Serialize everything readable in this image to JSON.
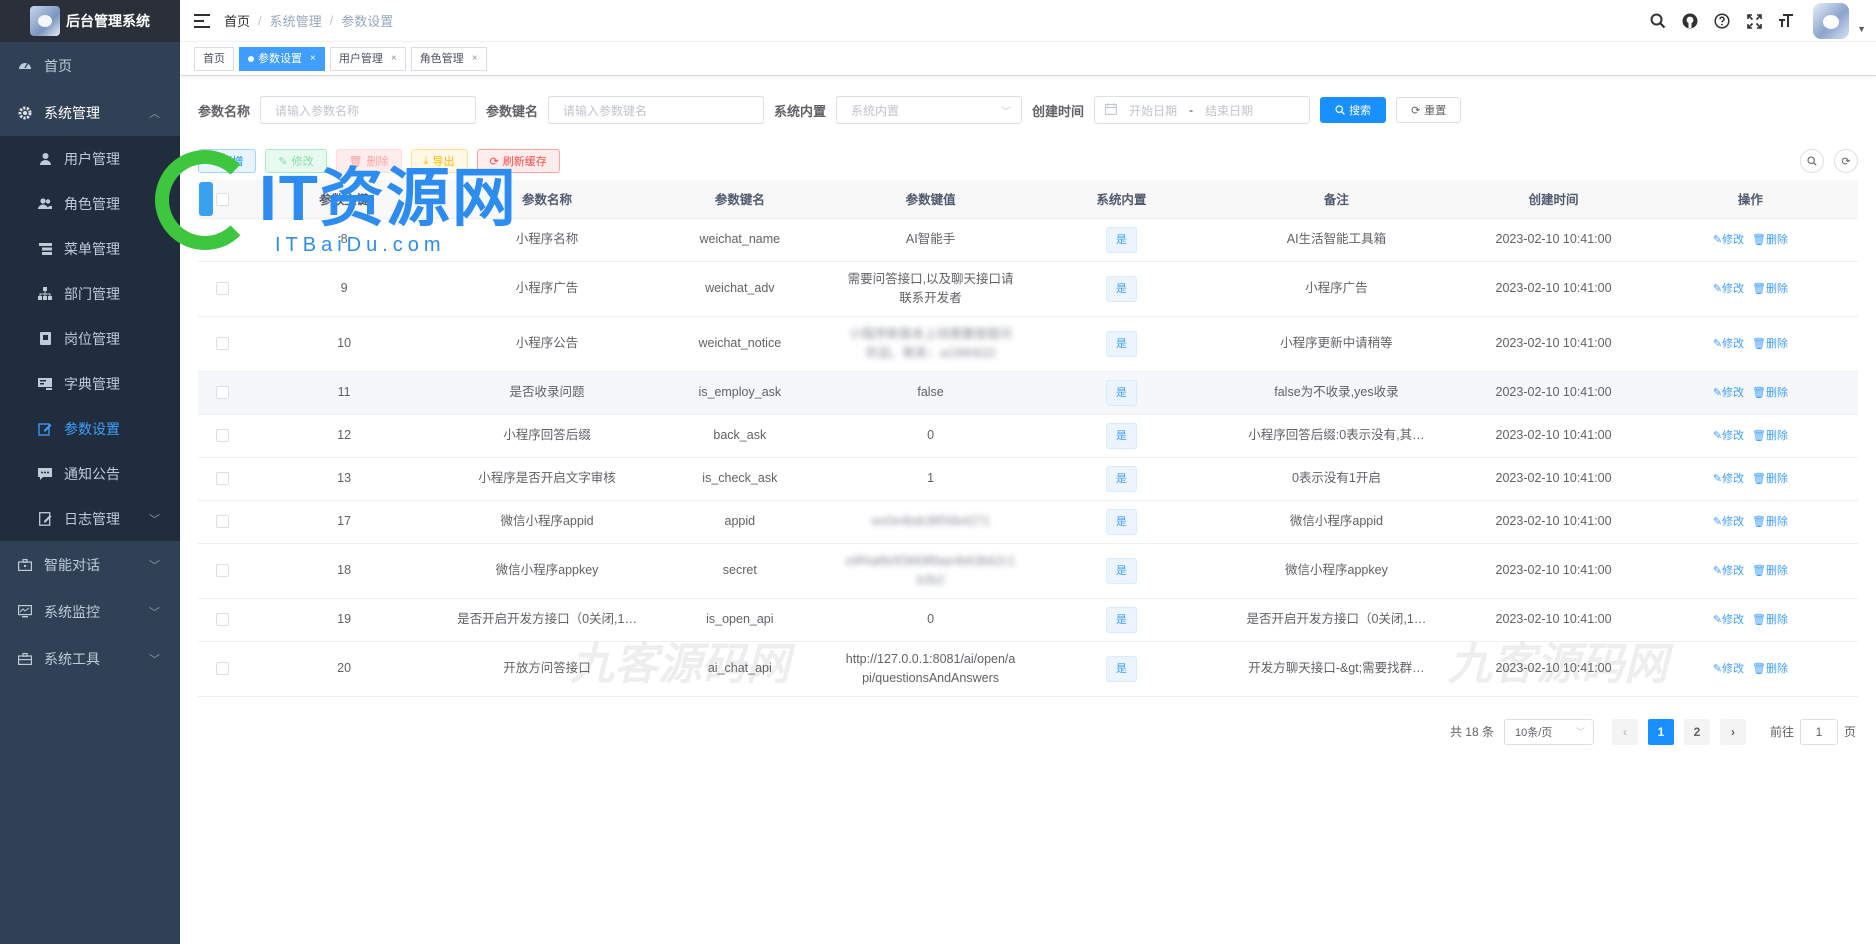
{
  "app": {
    "title": "后台管理系统"
  },
  "sidebar": {
    "items": [
      {
        "label": "首页",
        "icon": "dashboard-icon"
      },
      {
        "label": "系统管理",
        "icon": "gear-icon",
        "expanded": true,
        "children": [
          {
            "label": "用户管理",
            "icon": "user-icon"
          },
          {
            "label": "角色管理",
            "icon": "peoples-icon"
          },
          {
            "label": "菜单管理",
            "icon": "tree-table-icon"
          },
          {
            "label": "部门管理",
            "icon": "tree-icon"
          },
          {
            "label": "岗位管理",
            "icon": "post-icon"
          },
          {
            "label": "字典管理",
            "icon": "dict-icon"
          },
          {
            "label": "参数设置",
            "icon": "edit-icon",
            "active": true
          },
          {
            "label": "通知公告",
            "icon": "message-icon"
          },
          {
            "label": "日志管理",
            "icon": "log-icon"
          }
        ]
      },
      {
        "label": "智能对话",
        "icon": "briefcase-icon"
      },
      {
        "label": "系统监控",
        "icon": "monitor-icon"
      },
      {
        "label": "系统工具",
        "icon": "tool-icon"
      }
    ]
  },
  "breadcrumb": [
    "首页",
    "系统管理",
    "参数设置"
  ],
  "tags": [
    {
      "label": "首页"
    },
    {
      "label": "参数设置",
      "active": true
    },
    {
      "label": "用户管理"
    },
    {
      "label": "角色管理"
    }
  ],
  "tag_close": "×",
  "search": {
    "name_label": "参数名称",
    "name_placeholder": "请输入参数名称",
    "key_label": "参数键名",
    "key_placeholder": "请输入参数键名",
    "type_label": "系统内置",
    "type_placeholder": "系统内置",
    "time_label": "创建时间",
    "start_placeholder": "开始日期",
    "end_placeholder": "结束日期",
    "range_sep": "-",
    "search_btn": "搜索",
    "reset_btn": "重置"
  },
  "toolbar": {
    "add": "新增",
    "edit": "修改",
    "delete": "删除",
    "export": "导出",
    "refresh_cache": "刷新缓存"
  },
  "table": {
    "headers": [
      "参数主键",
      "参数名称",
      "参数键名",
      "参数键值",
      "系统内置",
      "备注",
      "创建时间",
      "操作"
    ],
    "op_edit": "修改",
    "op_delete": "删除",
    "rows": [
      {
        "id": "8",
        "name": "小程序名称",
        "key": "weichat_name",
        "value": "AI智能手",
        "type": "是",
        "remark": "AI生活智能工具箱",
        "time": "2023-02-10 10:41:00"
      },
      {
        "id": "9",
        "name": "小程序广告",
        "key": "weichat_adv",
        "value": "需要问答接口,以及聊天接口请联系开发者",
        "type": "是",
        "remark": "小程序广告",
        "time": "2023-02-10 10:41:00"
      },
      {
        "id": "10",
        "name": "小程序公告",
        "key": "weichat_notice",
        "value": "小程序新版本上线需要按提问欢迎。联系：a1990622",
        "blurred": true,
        "type": "是",
        "remark": "小程序更新中请稍等",
        "time": "2023-02-10 10:41:00"
      },
      {
        "id": "11",
        "name": "是否收录问题",
        "key": "is_employ_ask",
        "value": "false",
        "type": "是",
        "remark": "false为不收录,yes收录",
        "time": "2023-02-10 10:41:00"
      },
      {
        "id": "12",
        "name": "小程序回答后缀",
        "key": "back_ask",
        "value": "0",
        "type": "是",
        "remark": "小程序回答后缀:0表示没有,其…",
        "time": "2023-02-10 10:41:00"
      },
      {
        "id": "13",
        "name": "小程序是否开启文字审核",
        "key": "is_check_ask",
        "value": "1",
        "type": "是",
        "remark": "0表示没有1开启",
        "time": "2023-02-10 10:41:00"
      },
      {
        "id": "17",
        "name": "微信小程序appid",
        "key": "appid",
        "value": "wx0e4bdc8856b4271",
        "blurred": true,
        "type": "是",
        "remark": "微信小程序appid",
        "time": "2023-02-10 10:41:00"
      },
      {
        "id": "18",
        "name": "微信小程序appkey",
        "key": "secret",
        "value": "e9f4a8b0f3969f9ae4b63b62c1b2b2",
        "blurred": true,
        "type": "是",
        "remark": "微信小程序appkey",
        "time": "2023-02-10 10:41:00"
      },
      {
        "id": "19",
        "name": "是否开启开发方接口（0关闭,1…",
        "key": "is_open_api",
        "value": "0",
        "type": "是",
        "remark": "是否开启开发方接口（0关闭,1…",
        "time": "2023-02-10 10:41:00"
      },
      {
        "id": "20",
        "name": "开放方问答接口",
        "key": "ai_chat_api",
        "value": "http://127.0.0.1:8081/ai/open/api/questionsAndAnswers",
        "type": "是",
        "remark": "开发方聊天接口-&gt;需要找群…",
        "time": "2023-02-10 10:41:00"
      }
    ]
  },
  "pagination": {
    "total": "共 18 条",
    "page_size": "10条/页",
    "pages": [
      "1",
      "2"
    ],
    "current": "1",
    "goto_label": "前往",
    "goto_value": "1",
    "goto_suffix": "页",
    "prev": "‹",
    "next": "›"
  },
  "watermarks": {
    "logo_main": "IT资源网",
    "logo_sub": "ITBaiDu.com",
    "text1": "九客源码网",
    "text2": "九客源码网"
  },
  "colors": {
    "sidebar_bg": "#304156",
    "active": "#409eff",
    "primary": "#1890ff"
  }
}
